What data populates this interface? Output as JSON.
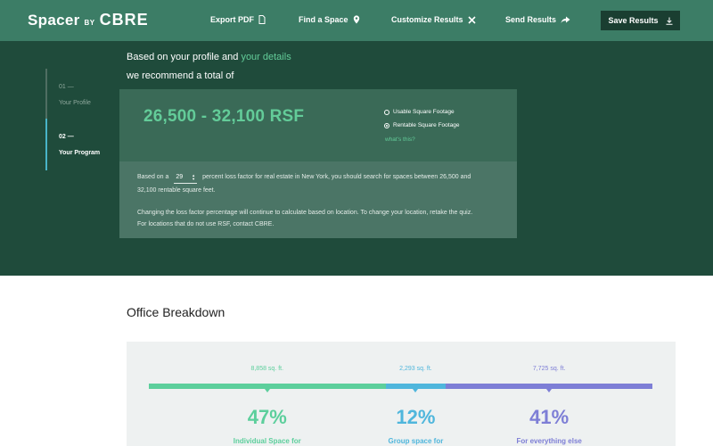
{
  "header": {
    "logo_word": "Spacer",
    "logo_by": "BY",
    "logo_brand": "CBRE",
    "nav": {
      "export_pdf": "Export PDF",
      "find_space": "Find a Space",
      "customize": "Customize Results",
      "send_results": "Send Results"
    },
    "save_label": "Save Results"
  },
  "intro": {
    "line1_prefix": "Based on your profile and",
    "line1_link": "your details",
    "line2": "we recommend a total of"
  },
  "steps": [
    {
      "num": "01 —",
      "label": "Your Profile"
    },
    {
      "num": "02 —",
      "label": "Your Program"
    }
  ],
  "rsf": {
    "range": "26,500 - 32,100 RSF",
    "options": [
      "Usable Square Footage",
      "Rentable Square Footage"
    ],
    "selected_option": "Rentable Square Footage",
    "whats_this": "what's this?"
  },
  "loss": {
    "prefix": "Based on a",
    "value": "29",
    "suffix": "percent loss factor for real estate in New York, you should search for spaces between 26,500 and",
    "line2": "32,100 rentable square feet.",
    "line3": "Changing the loss factor percentage will continue to calculate based on location. To change your location, retake the quiz.",
    "line4": "For locations that do not use RSF, contact CBRE."
  },
  "breakdown": {
    "title": "Office Breakdown",
    "segments": [
      {
        "sqft": "8,858 sq. ft.",
        "percent": "47%",
        "fraction": 0.47,
        "label": "Individual Space for",
        "color": "#5ccf9c"
      },
      {
        "sqft": "2,293 sq. ft.",
        "percent": "12%",
        "fraction": 0.12,
        "label": "Group space for",
        "color": "#4fb6dc"
      },
      {
        "sqft": "7,725 sq. ft.",
        "percent": "41%",
        "fraction": 0.41,
        "label": "For everything else",
        "color": "#7d7ed6"
      }
    ]
  },
  "colors": {
    "header_bg": "#3c7d66",
    "hero_bg": "#1f4b3b",
    "accent_green": "#63cc99"
  }
}
